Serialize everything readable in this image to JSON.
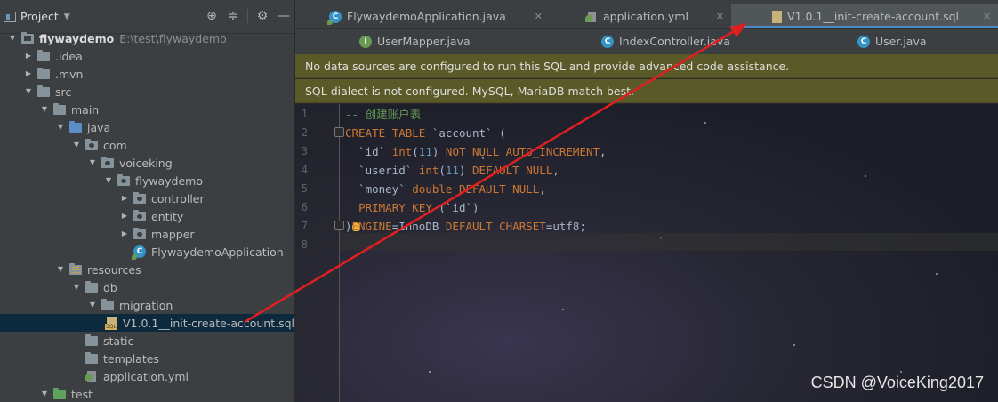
{
  "project": {
    "title": "Project",
    "tools": [
      "crosshair-icon",
      "collapse-icon",
      "gear-icon",
      "minimize-icon"
    ],
    "tree": [
      {
        "label": "flywaydemo",
        "path": "E:\\test\\flywaydemo",
        "bold": true,
        "expanded": true,
        "icon": "module-folder"
      },
      {
        "label": ".idea",
        "expanded": false,
        "icon": "folder"
      },
      {
        "label": ".mvn",
        "expanded": false,
        "icon": "folder"
      },
      {
        "label": "src",
        "expanded": true,
        "icon": "folder"
      },
      {
        "label": "main",
        "expanded": true,
        "icon": "folder"
      },
      {
        "label": "java",
        "expanded": true,
        "icon": "source-folder"
      },
      {
        "label": "com",
        "expanded": true,
        "icon": "package"
      },
      {
        "label": "voiceking",
        "expanded": true,
        "icon": "package"
      },
      {
        "label": "flywaydemo",
        "expanded": true,
        "icon": "package"
      },
      {
        "label": "controller",
        "expanded": false,
        "icon": "package"
      },
      {
        "label": "entity",
        "expanded": false,
        "icon": "package"
      },
      {
        "label": "mapper",
        "expanded": false,
        "icon": "package"
      },
      {
        "label": "FlywaydemoApplication",
        "icon": "spring-class"
      },
      {
        "label": "resources",
        "expanded": true,
        "icon": "resources-folder"
      },
      {
        "label": "db",
        "expanded": true,
        "icon": "folder"
      },
      {
        "label": "migration",
        "expanded": true,
        "icon": "folder"
      },
      {
        "label": "V1.0.1__init-create-account.sql",
        "icon": "sql-file",
        "selected": true
      },
      {
        "label": "static",
        "icon": "folder"
      },
      {
        "label": "templates",
        "icon": "folder"
      },
      {
        "label": "application.yml",
        "icon": "yml-file"
      },
      {
        "label": "test",
        "expanded": true,
        "icon": "test-folder"
      }
    ]
  },
  "tabs_row1": [
    {
      "label": "FlywaydemoApplication.java",
      "icon": "spring-class"
    },
    {
      "label": "application.yml",
      "icon": "yml-file"
    },
    {
      "label": "V1.0.1__init-create-account.sql",
      "icon": "sql-file",
      "active": true
    }
  ],
  "tabs_row2": [
    {
      "label": "UserMapper.java",
      "icon": "interface"
    },
    {
      "label": "IndexController.java",
      "icon": "class"
    },
    {
      "label": "User.java",
      "icon": "class"
    }
  ],
  "tab_close": "✕",
  "banners": {
    "datasource": "No data sources are configured to run this SQL and provide advanced code assistance.",
    "dialect": "SQL dialect is not configured. MySQL, MariaDB match best."
  },
  "code": {
    "line_numbers": [
      "1",
      "2",
      "3",
      "4",
      "5",
      "6",
      "7",
      "8"
    ],
    "lines": [
      "-- 创建账户表",
      "CREATE TABLE `account` (",
      "  `id` int(11) NOT NULL AUTO_INCREMENT,",
      "  `userid` int(11) DEFAULT NULL,",
      "  `money` double DEFAULT NULL,",
      "  PRIMARY KEY (`id`)",
      ")ENGINE=InnoDB DEFAULT CHARSET=utf8;",
      ""
    ]
  },
  "watermark": "CSDN @VoiceKing2017",
  "colors": {
    "annotation_arrow": "#e02020",
    "selection": "#0d293e",
    "active_tab_underline": "#4a88c7",
    "banner_bg": "#5a5a28"
  }
}
